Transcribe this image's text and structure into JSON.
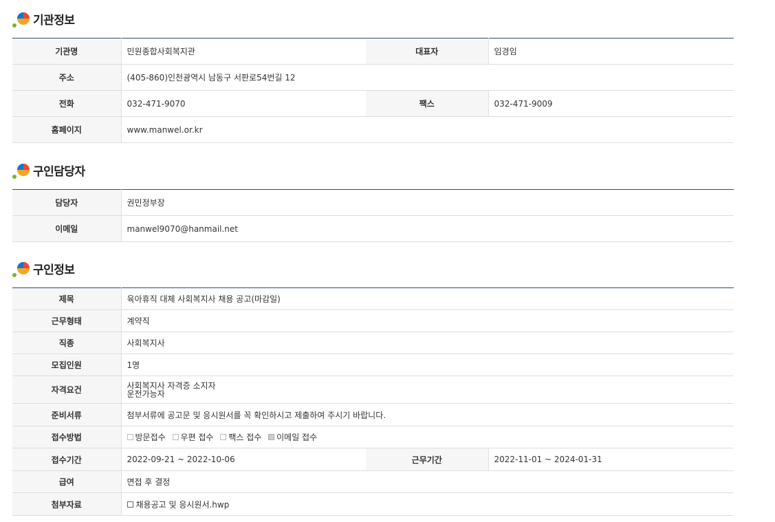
{
  "org_section": {
    "title": "기관정보",
    "rows": {
      "name_label": "기관명",
      "name_value": "민원종합사회복지관",
      "rep_label": "대표자",
      "rep_value": "임경임",
      "addr_label": "주소",
      "addr_value": "(405-860)인천광역시 남동구 서판로54번길 12",
      "phone_label": "전화",
      "phone_value": "032-471-9070",
      "fax_label": "팩스",
      "fax_value": "032-471-9009",
      "homepage_label": "홈페이지",
      "homepage_value": "www.manwel.or.kr"
    }
  },
  "contact_section": {
    "title": "구인담당자",
    "rows": {
      "person_label": "담당자",
      "person_value": "권민정부장",
      "email_label": "이메일",
      "email_value": "manwel9070@hanmail.net"
    }
  },
  "job_section": {
    "title": "구인정보",
    "rows": {
      "subject_label": "제목",
      "subject_value": "육아휴직 대체 사회복지사 채용 공고(마감일)",
      "worktype_label": "근무형태",
      "worktype_value": "계약직",
      "jobtype_label": "직종",
      "jobtype_value": "사회복지사",
      "headcount_label": "모집인원",
      "headcount_value": "1명",
      "qual_label": "자격요건",
      "qual_line1": "사회복지사 자격증 소지자",
      "qual_line2": "운전가능자",
      "docs_label": "준비서류",
      "docs_value": "첨부서류에 공고문 및 응시원서를 꼭 확인하시고 제출하여 주시기 바랍니다.",
      "method_label": "접수방법",
      "methods": [
        {
          "label": "방문접수",
          "checked": false
        },
        {
          "label": "우편 접수",
          "checked": false
        },
        {
          "label": "팩스 접수",
          "checked": false
        },
        {
          "label": "이메일 접수",
          "checked": true
        }
      ],
      "period_label": "접수기간",
      "period_value": "2022-09-21 ~ 2022-10-06",
      "workperiod_label": "근무기간",
      "workperiod_value": "2022-11-01 ~ 2024-01-31",
      "salary_label": "급여",
      "salary_value": "면접 후 결정",
      "attach_label": "첨부자료",
      "attach_value": "채용공고 및 응시원서.hwp"
    }
  }
}
